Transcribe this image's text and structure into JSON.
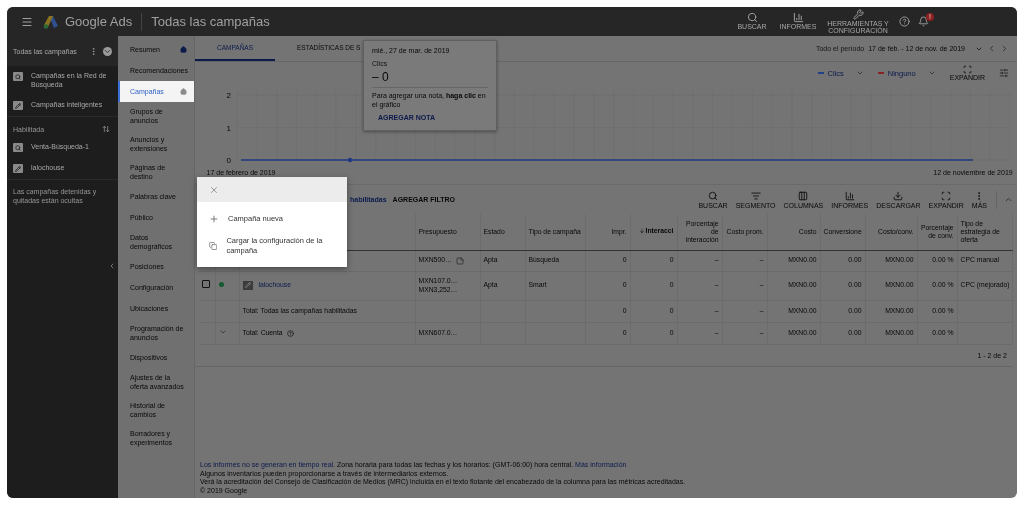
{
  "header": {
    "title": "Google Ads",
    "page_title": "Todas las campañas",
    "actions": [
      {
        "kind": "search",
        "label": "BUSCAR"
      },
      {
        "kind": "reports",
        "label": "INFORMES"
      },
      {
        "kind": "tools",
        "label": "HERRAMIENTAS Y CONFIGURACIÓN"
      }
    ],
    "notification_badge": "!"
  },
  "sidebar": {
    "title": "Todas las campañas",
    "types": [
      {
        "kind": "search",
        "label": "Campañas en la Red de Búsqueda"
      },
      {
        "kind": "smart",
        "label": "Campañas inteligentes"
      }
    ],
    "section": "Habilitada",
    "campaigns": [
      {
        "kind": "search",
        "label": "Venta-Búsqueda-1"
      },
      {
        "kind": "smart",
        "label": "lalochouse"
      }
    ],
    "note": "Las campañas detenidas y quitadas están ocultas"
  },
  "nav": {
    "items": [
      {
        "label": "Resumen",
        "selected": false,
        "home": true
      },
      {
        "label": "Recomendaciones",
        "selected": false,
        "home": false
      },
      {
        "label": "Campañas",
        "selected": true,
        "home": true
      },
      {
        "label": "Grupos de anuncios",
        "selected": false,
        "home": false
      },
      {
        "label": "Anuncios y extensiones",
        "selected": false,
        "home": false
      },
      {
        "label": "Páginas de destino",
        "selected": false,
        "home": false
      },
      {
        "label": "Palabras clave",
        "selected": false,
        "home": false
      },
      {
        "label": "Público",
        "selected": false,
        "home": false
      },
      {
        "label": "Datos demográficos",
        "selected": false,
        "home": false
      },
      {
        "label": "Posiciones",
        "selected": false,
        "home": false
      },
      {
        "label": "Configuración",
        "selected": false,
        "home": false
      },
      {
        "label": "Ubicaciones",
        "selected": false,
        "home": false
      },
      {
        "label": "Programación de anuncios",
        "selected": false,
        "home": false
      },
      {
        "label": "Dispositivos",
        "selected": false,
        "home": false
      },
      {
        "label": "Ajustes de la oferta avanzados",
        "selected": false,
        "home": false
      },
      {
        "label": "Historial de cambios",
        "selected": false,
        "home": false
      },
      {
        "label": "Borradores y experimentos",
        "selected": false,
        "home": false
      }
    ]
  },
  "tabs": [
    {
      "label": "CAMPAÑAS",
      "selected": true
    },
    {
      "label": "ESTADÍSTICAS DE S",
      "selected": false
    }
  ],
  "date_range": {
    "label": "Todo el período",
    "range": "17 de feb. - 12 de nov. de 2019"
  },
  "chart_controls": {
    "metrics": [
      {
        "label": "Clics",
        "color": "#23408a"
      },
      {
        "label": "Ninguno",
        "color": "#8a2323"
      }
    ],
    "expand_label": "EXPANDIR"
  },
  "chart": {
    "chart_data": {
      "type": "line",
      "x": [
        "17 de febrero de 2019",
        "12 de noviembre de 2019"
      ],
      "series": [
        {
          "color": "#1f3a80",
          "values": [
            0,
            0
          ]
        }
      ],
      "ylim": [
        0,
        2
      ],
      "yticks": [
        0,
        1,
        2
      ]
    }
  },
  "tooltip": {
    "date": "mié., 27 de mar. de 2019",
    "metric": "Clics",
    "value": "– 0",
    "hint": "Para agregar una nota, **haga clic** en el gráfico",
    "action": "AGREGAR NOTA"
  },
  "filters": {
    "chip": "habilitadas",
    "add": "AGREGAR FILTRO"
  },
  "table_tools": [
    {
      "kind": "search",
      "label": "BUSCAR"
    },
    {
      "kind": "segment",
      "label": "SEGMENTO"
    },
    {
      "kind": "columns",
      "label": "COLUMNAS"
    },
    {
      "kind": "reports",
      "label": "INFORMES"
    },
    {
      "kind": "download",
      "label": "DESCARGAR"
    },
    {
      "kind": "expand",
      "label": "EXPANDIR"
    },
    {
      "kind": "more",
      "label": "MÁS"
    }
  ],
  "table": {
    "columns": [
      {
        "label": "Presupuesto",
        "sorted": false
      },
      {
        "label": "Estado",
        "sorted": false
      },
      {
        "label": "Tipo de campaña",
        "sorted": false
      },
      {
        "label": "Impr.",
        "sorted": false
      },
      {
        "label": "Interacci",
        "sorted": true
      },
      {
        "label": "Porcentaje de interacción",
        "sorted": false
      },
      {
        "label": "Costo prom.",
        "sorted": false
      },
      {
        "label": "Costo",
        "sorted": false
      },
      {
        "label": "Conversione",
        "sorted": false
      },
      {
        "label": "Costo/conv.",
        "sorted": false
      },
      {
        "label": "Porcentaje de conv.",
        "sorted": false
      },
      {
        "label": "Tipo de estrategia de oferta",
        "sorted": false
      }
    ],
    "rows": [
      {
        "kind": "covered",
        "budget_note": true,
        "cells": [
          "MXN500…",
          "Apta",
          "Búsqueda",
          "0",
          "0",
          "–",
          "–",
          "MXN0.00",
          "0.00",
          "MXN0.00",
          "0.00 %",
          "CPC manual"
        ]
      },
      {
        "kind": "campaign",
        "checked": false,
        "color": "#145a32",
        "name": "lalochouse",
        "cells": [
          [
            "MXN107.0…",
            "MXN3,252…"
          ],
          "Apta",
          "Smart",
          "0",
          "0",
          "–",
          "–",
          "MXN0.00",
          "0.00",
          "MXN0.00",
          "0.00 %",
          "CPC (mejorado)"
        ]
      },
      {
        "kind": "total",
        "label": "Total: Todas las campañas habilitadas",
        "cells": [
          null,
          null,
          null,
          "0",
          "0",
          "–",
          "–",
          "MXN0.00",
          "0.00",
          "MXN0.00",
          "0.00 %",
          null
        ]
      },
      {
        "kind": "account_total",
        "label": "Total: Cuenta",
        "cells": [
          "MXN607.0…",
          null,
          null,
          "0",
          "0",
          "–",
          "–",
          "MXN0.00",
          "0.00",
          "MXN0.00",
          "0.00 %",
          null
        ]
      }
    ],
    "pagination": "1 - 2 de 2"
  },
  "menu": {
    "items": [
      {
        "kind": "add",
        "label": "Campaña nueva"
      },
      {
        "kind": "copy",
        "label": "Cargar la configuración de la campaña"
      }
    ]
  },
  "footer": {
    "notice": [
      {
        "kind": "link",
        "text": "Los informes no se generan en tiempo real."
      },
      {
        "kind": "text",
        "text": "Zona horaria para todas las fechas y los horarios: (GMT-06:00) hora central."
      },
      {
        "kind": "link",
        "text": "Más información"
      }
    ],
    "lines": [
      "Algunos inventarios pueden proporcionarse a través de intermediarios externos.",
      "Verá la acreditación del Consejo de Clasificación de Medios (MRC) incluida en el texto flotante del encabezado de la columna para las métricas acreditadas."
    ],
    "copyright": "© 2019 Google"
  }
}
